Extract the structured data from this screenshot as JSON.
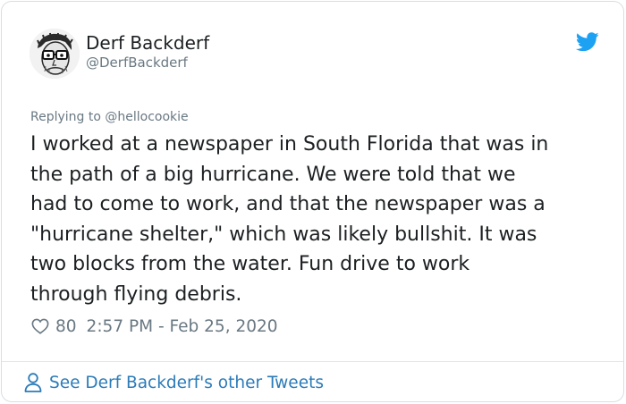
{
  "author": {
    "display_name": "Derf Backderf",
    "handle": "@DerfBackderf",
    "avatar_icon": "caricature-avatar",
    "brand_icon": "twitter-bird-icon"
  },
  "reply": {
    "prefix": "Replying to ",
    "mention": "@hellocookie"
  },
  "tweet": {
    "lines": [
      "I worked at a newspaper in South Florida that was in",
      "the path of a big hurricane. We were told that we",
      "had to come to work, and that the newspaper was a",
      "\"hurricane shelter,\" which was likely bullshit. It was",
      "two blocks from the water. Fun drive to work",
      "through flying debris."
    ]
  },
  "meta": {
    "like_icon": "heart-icon",
    "likes": "80",
    "timestamp": "2:57 PM - Feb 25, 2020"
  },
  "footer": {
    "icon": "person-icon",
    "link_text": "See Derf Backderf's other Tweets"
  },
  "colors": {
    "text": "#1c2022",
    "muted": "#697882",
    "link": "#2b7bb9",
    "twitter_blue": "#1da1f2",
    "border": "#d9dee2"
  }
}
